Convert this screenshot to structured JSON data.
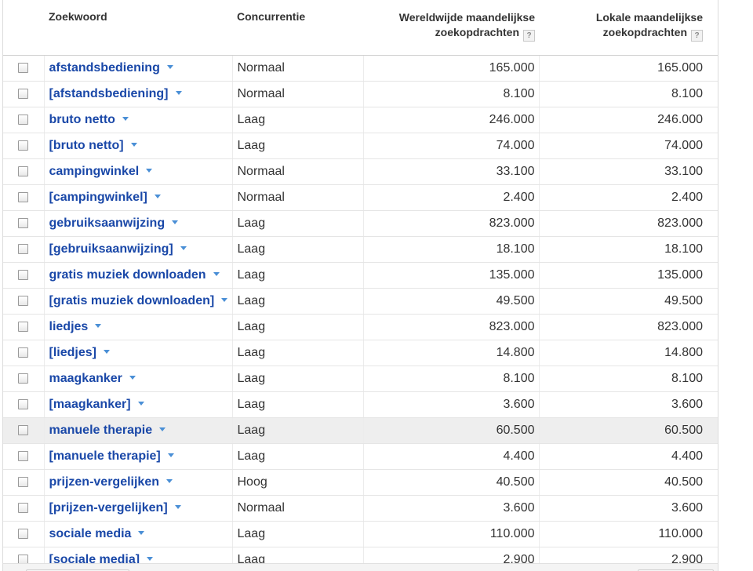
{
  "columns": {
    "keyword": "Zoekwoord",
    "competition": "Concurrentie",
    "global_line1": "Wereldwijde maandelijkse",
    "global_line2": "zoekopdrachten",
    "local_line1": "Lokale maandelijkse",
    "local_line2": "zoekopdrachten",
    "help": "?"
  },
  "rows": [
    {
      "keyword": "afstandsbediening",
      "competition": "Normaal",
      "global": "165.000",
      "local": "165.000"
    },
    {
      "keyword": "[afstandsbediening]",
      "competition": "Normaal",
      "global": "8.100",
      "local": "8.100"
    },
    {
      "keyword": "bruto netto",
      "competition": "Laag",
      "global": "246.000",
      "local": "246.000"
    },
    {
      "keyword": "[bruto netto]",
      "competition": "Laag",
      "global": "74.000",
      "local": "74.000"
    },
    {
      "keyword": "campingwinkel",
      "competition": "Normaal",
      "global": "33.100",
      "local": "33.100"
    },
    {
      "keyword": "[campingwinkel]",
      "competition": "Normaal",
      "global": "2.400",
      "local": "2.400"
    },
    {
      "keyword": "gebruiksaanwijzing",
      "competition": "Laag",
      "global": "823.000",
      "local": "823.000"
    },
    {
      "keyword": "[gebruiksaanwijzing]",
      "competition": "Laag",
      "global": "18.100",
      "local": "18.100"
    },
    {
      "keyword": "gratis muziek downloaden",
      "competition": "Laag",
      "global": "135.000",
      "local": "135.000"
    },
    {
      "keyword": "[gratis muziek downloaden]",
      "competition": "Laag",
      "global": "49.500",
      "local": "49.500"
    },
    {
      "keyword": "liedjes",
      "competition": "Laag",
      "global": "823.000",
      "local": "823.000"
    },
    {
      "keyword": "[liedjes]",
      "competition": "Laag",
      "global": "14.800",
      "local": "14.800"
    },
    {
      "keyword": "maagkanker",
      "competition": "Laag",
      "global": "8.100",
      "local": "8.100"
    },
    {
      "keyword": "[maagkanker]",
      "competition": "Laag",
      "global": "3.600",
      "local": "3.600"
    },
    {
      "keyword": "manuele therapie",
      "competition": "Laag",
      "global": "60.500",
      "local": "60.500"
    },
    {
      "keyword": "[manuele therapie]",
      "competition": "Laag",
      "global": "4.400",
      "local": "4.400"
    },
    {
      "keyword": "prijzen-vergelijken",
      "competition": "Hoog",
      "global": "40.500",
      "local": "40.500"
    },
    {
      "keyword": "[prijzen-vergelijken]",
      "competition": "Normaal",
      "global": "3.600",
      "local": "3.600"
    },
    {
      "keyword": "sociale media",
      "competition": "Laag",
      "global": "110.000",
      "local": "110.000"
    },
    {
      "keyword": "[sociale media]",
      "competition": "Laag",
      "global": "2.900",
      "local": "2.900"
    }
  ],
  "hovered_row_index": 14,
  "icons": {
    "dropdown": "chevron-down-icon",
    "help": "help-icon",
    "checkbox": "checkbox"
  },
  "colors": {
    "link": "#1a48a8",
    "arrow": "#4a8fd6",
    "hover_row": "#eeeeee"
  }
}
